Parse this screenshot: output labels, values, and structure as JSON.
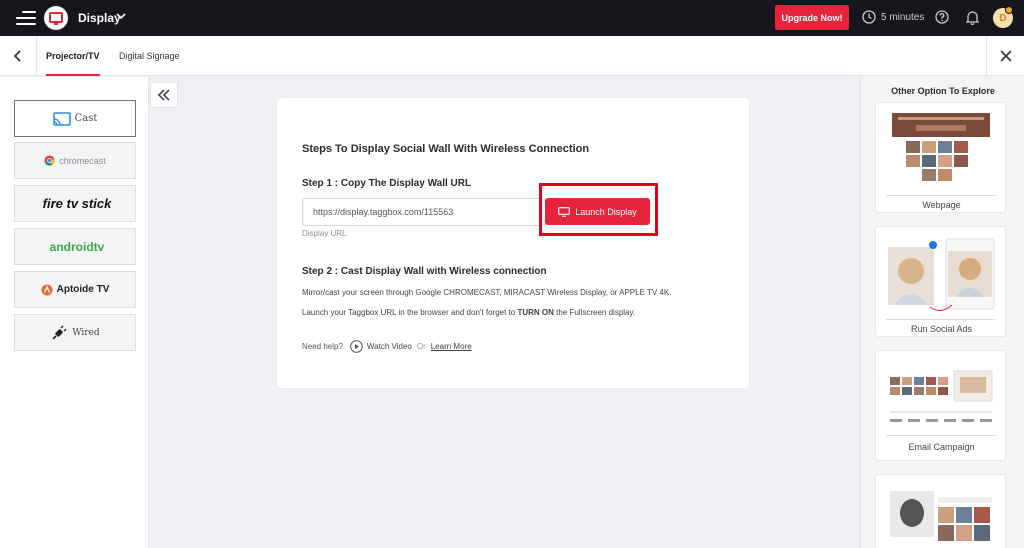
{
  "topbar": {
    "app_title": "Display",
    "upgrade_label": "Upgrade Now!",
    "time_label": "5 minutes",
    "avatar_initial": "D"
  },
  "subbar": {
    "tabs": [
      {
        "label": "Projector/TV",
        "active": true
      },
      {
        "label": "Digital Signage",
        "active": false
      }
    ]
  },
  "sidebar": {
    "devices": [
      {
        "label": "Cast",
        "icon": "cast-icon",
        "active": true
      },
      {
        "label": "chromecast",
        "icon": "chrome-icon",
        "active": false
      },
      {
        "label": "fire tv stick",
        "icon": "firetv-logo",
        "active": false
      },
      {
        "label": "androidtv",
        "icon": "androidtv-logo",
        "active": false
      },
      {
        "label": "Aptoide TV",
        "icon": "aptoide-icon",
        "active": false
      },
      {
        "label": "Wired",
        "icon": "plug-icon",
        "active": false
      }
    ]
  },
  "main": {
    "title": "Steps To Display Social Wall With Wireless Connection",
    "step1_heading": "Step 1 : Copy The Display Wall URL",
    "url_value": "https://display.taggbox.com/115563",
    "url_caption": "Display URL",
    "launch_label": "Launch Display",
    "step2_heading": "Step 2 : Cast Display Wall with Wireless connection",
    "desc1": "Mirror/cast your screen through Google CHROMECAST, MIRACAST Wireless Display, or APPLE TV 4K.",
    "desc2_pre": "Launch your Taggbox URL in the browser and don't forget to ",
    "desc2_bold": "TURN ON",
    "desc2_post": " the Fullscreen display.",
    "help_label": "Need help?",
    "watch_label": "Watch Video",
    "or_label": "Or",
    "learn_label": "Learn More"
  },
  "right_panel": {
    "title": "Other Option To Explore",
    "options": [
      {
        "label": "Webpage"
      },
      {
        "label": "Run Social Ads"
      },
      {
        "label": "Email Campaign"
      },
      {
        "label": ""
      }
    ]
  },
  "colors": {
    "accent": "#e8243c",
    "topbar": "#15171c",
    "highlight_border": "#e0061c"
  }
}
